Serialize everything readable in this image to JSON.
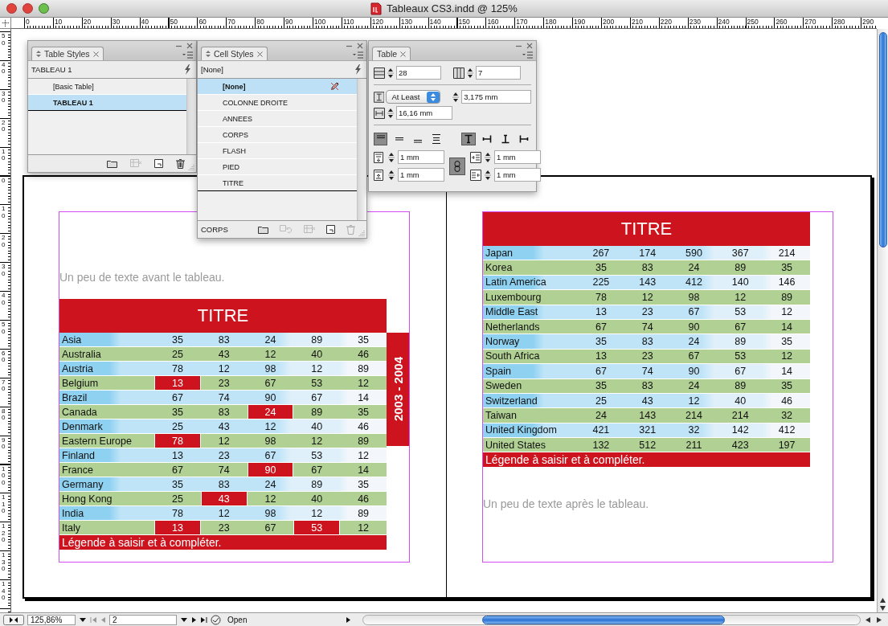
{
  "window": {
    "title": "Tableaux CS3.indd @ 125%"
  },
  "top_ruler": {
    "labels": [
      "0",
      "10",
      "20",
      "30",
      "40",
      "50",
      "60",
      "70",
      "80",
      "90",
      "100",
      "110",
      "120",
      "130",
      "140",
      "150",
      "160",
      "170",
      "180",
      "190",
      "200",
      "210",
      "220",
      "230",
      "240",
      "250",
      "260",
      "270",
      "280",
      "290"
    ]
  },
  "left_ruler": {
    "labels": [
      "50",
      "40",
      "30",
      "20",
      "10",
      "0",
      "10",
      "20",
      "30",
      "40",
      "50",
      "60",
      "70",
      "80",
      "90",
      "100",
      "110",
      "120",
      "130",
      "140"
    ]
  },
  "table_styles_panel": {
    "tab": "Table Styles",
    "current": "TABLEAU 1",
    "items": [
      {
        "label": "[Basic Table]",
        "selected": false
      },
      {
        "label": "TABLEAU 1",
        "selected": true
      }
    ]
  },
  "cell_styles_panel": {
    "tab": "Cell Styles",
    "current": "[None]",
    "items": [
      {
        "label": "[None]",
        "selected": true,
        "locked": true
      },
      {
        "label": "COLONNE DROITE",
        "selected": false,
        "locked": false
      },
      {
        "label": "ANNEES",
        "selected": false,
        "locked": false
      },
      {
        "label": "CORPS",
        "selected": false,
        "locked": false
      },
      {
        "label": "FLASH",
        "selected": false,
        "locked": false
      },
      {
        "label": "PIED",
        "selected": false,
        "locked": false
      },
      {
        "label": "TITRE",
        "selected": false,
        "locked": false
      }
    ],
    "footer_label": "CORPS"
  },
  "table_panel": {
    "tab": "Table",
    "body_rows": "28",
    "columns": "7",
    "row_height_mode": "At Least",
    "row_height": "3,175 mm",
    "column_width": "16,16 mm",
    "vertical_alignment": [
      {
        "kind": "top",
        "selected": true
      },
      {
        "kind": "center",
        "selected": false
      },
      {
        "kind": "bottom",
        "selected": false
      },
      {
        "kind": "justify",
        "selected": false
      }
    ],
    "text_rotation": [
      {
        "kind": "rotate-0",
        "selected": true
      },
      {
        "kind": "rotate-90",
        "selected": false
      },
      {
        "kind": "rotate-180",
        "selected": false
      },
      {
        "kind": "rotate-270",
        "selected": false
      }
    ],
    "top_inset": "1 mm",
    "bottom_inset": "1 mm",
    "left_inset": "1 mm",
    "right_inset": "1 mm",
    "insets_linked": true
  },
  "left_page": {
    "intro_text": "Un peu de texte avant le tableau.",
    "side_label": "2003 - 2004",
    "table": {
      "title": "TITRE",
      "legend": "Légende à saisir et à compléter.",
      "rows": [
        {
          "name": "Asia",
          "values": [
            "35",
            "83",
            "24",
            "89",
            "35"
          ],
          "flagged": [
            false,
            false,
            false,
            false,
            false
          ]
        },
        {
          "name": "Australia",
          "values": [
            "25",
            "43",
            "12",
            "40",
            "46"
          ],
          "flagged": [
            false,
            false,
            false,
            false,
            false
          ]
        },
        {
          "name": "Austria",
          "values": [
            "78",
            "12",
            "98",
            "12",
            "89"
          ],
          "flagged": [
            false,
            false,
            false,
            false,
            false
          ]
        },
        {
          "name": "Belgium",
          "values": [
            "13",
            "23",
            "67",
            "53",
            "12"
          ],
          "flagged": [
            true,
            false,
            false,
            false,
            false
          ]
        },
        {
          "name": "Brazil",
          "values": [
            "67",
            "74",
            "90",
            "67",
            "14"
          ],
          "flagged": [
            false,
            false,
            false,
            false,
            false
          ]
        },
        {
          "name": "Canada",
          "values": [
            "35",
            "83",
            "24",
            "89",
            "35"
          ],
          "flagged": [
            false,
            false,
            true,
            false,
            false
          ]
        },
        {
          "name": "Denmark",
          "values": [
            "25",
            "43",
            "12",
            "40",
            "46"
          ],
          "flagged": [
            false,
            false,
            false,
            false,
            false
          ]
        },
        {
          "name": "Eastern Europe",
          "values": [
            "78",
            "12",
            "98",
            "12",
            "89"
          ],
          "flagged": [
            true,
            false,
            false,
            false,
            false
          ]
        },
        {
          "name": "Finland",
          "values": [
            "13",
            "23",
            "67",
            "53",
            "12"
          ],
          "flagged": [
            false,
            false,
            false,
            false,
            false
          ]
        },
        {
          "name": "France",
          "values": [
            "67",
            "74",
            "90",
            "67",
            "14"
          ],
          "flagged": [
            false,
            false,
            true,
            false,
            false
          ]
        },
        {
          "name": "Germany",
          "values": [
            "35",
            "83",
            "24",
            "89",
            "35"
          ],
          "flagged": [
            false,
            false,
            false,
            false,
            false
          ]
        },
        {
          "name": "Hong Kong",
          "values": [
            "25",
            "43",
            "12",
            "40",
            "46"
          ],
          "flagged": [
            false,
            true,
            false,
            false,
            false
          ]
        },
        {
          "name": "India",
          "values": [
            "78",
            "12",
            "98",
            "12",
            "89"
          ],
          "flagged": [
            false,
            false,
            false,
            false,
            false
          ]
        },
        {
          "name": "Italy",
          "values": [
            "13",
            "23",
            "67",
            "53",
            "12"
          ],
          "flagged": [
            true,
            false,
            false,
            true,
            false
          ]
        }
      ]
    }
  },
  "right_page": {
    "table": {
      "title": "TITRE",
      "legend": "Légende à saisir et à compléter.",
      "rows": [
        {
          "name": "Japan",
          "values": [
            "267",
            "174",
            "590",
            "367",
            "214"
          ],
          "flagged": [
            false,
            false,
            false,
            false,
            false
          ]
        },
        {
          "name": "Korea",
          "values": [
            "35",
            "83",
            "24",
            "89",
            "35"
          ],
          "flagged": [
            false,
            false,
            false,
            false,
            false
          ]
        },
        {
          "name": "Latin America",
          "values": [
            "225",
            "143",
            "412",
            "140",
            "146"
          ],
          "flagged": [
            false,
            false,
            false,
            false,
            false
          ]
        },
        {
          "name": "Luxembourg",
          "values": [
            "78",
            "12",
            "98",
            "12",
            "89"
          ],
          "flagged": [
            false,
            false,
            false,
            false,
            false
          ]
        },
        {
          "name": "Middle East",
          "values": [
            "13",
            "23",
            "67",
            "53",
            "12"
          ],
          "flagged": [
            false,
            false,
            false,
            false,
            false
          ]
        },
        {
          "name": "Netherlands",
          "values": [
            "67",
            "74",
            "90",
            "67",
            "14"
          ],
          "flagged": [
            false,
            false,
            false,
            false,
            false
          ]
        },
        {
          "name": "Norway",
          "values": [
            "35",
            "83",
            "24",
            "89",
            "35"
          ],
          "flagged": [
            false,
            false,
            false,
            false,
            false
          ]
        },
        {
          "name": "South Africa",
          "values": [
            "13",
            "23",
            "67",
            "53",
            "12"
          ],
          "flagged": [
            false,
            false,
            false,
            false,
            false
          ]
        },
        {
          "name": "Spain",
          "values": [
            "67",
            "74",
            "90",
            "67",
            "14"
          ],
          "flagged": [
            false,
            false,
            false,
            false,
            false
          ]
        },
        {
          "name": "Sweden",
          "values": [
            "35",
            "83",
            "24",
            "89",
            "35"
          ],
          "flagged": [
            false,
            false,
            false,
            false,
            false
          ]
        },
        {
          "name": "Switzerland",
          "values": [
            "25",
            "43",
            "12",
            "40",
            "46"
          ],
          "flagged": [
            false,
            false,
            false,
            false,
            false
          ]
        },
        {
          "name": "Taiwan",
          "values": [
            "24",
            "143",
            "214",
            "214",
            "32"
          ],
          "flagged": [
            false,
            false,
            false,
            false,
            false
          ]
        },
        {
          "name": "United Kingdom",
          "values": [
            "421",
            "321",
            "32",
            "142",
            "412"
          ],
          "flagged": [
            false,
            false,
            false,
            false,
            false
          ]
        },
        {
          "name": "United States",
          "values": [
            "132",
            "512",
            "211",
            "423",
            "197"
          ],
          "flagged": [
            false,
            false,
            false,
            false,
            false
          ]
        }
      ]
    },
    "outro_text": "Un peu de texte après le tableau."
  },
  "status_bar": {
    "zoom": "125,86%",
    "page": "2",
    "status": "Open"
  }
}
